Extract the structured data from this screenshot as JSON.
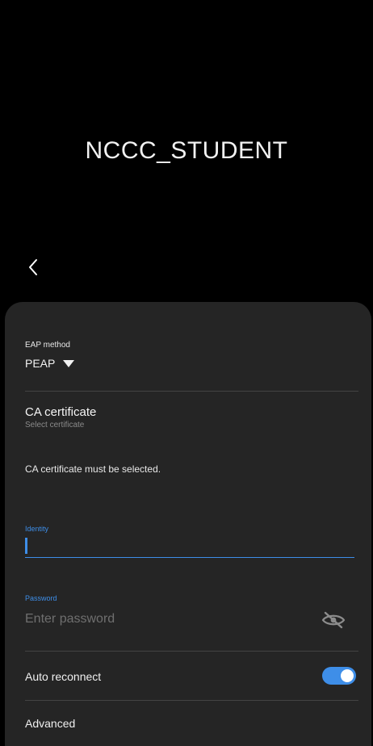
{
  "header": {
    "network_name": "NCCC_STUDENT"
  },
  "form": {
    "eap_method_label": "EAP method",
    "eap_method_value": "PEAP",
    "ca_certificate_title": "CA certificate",
    "ca_certificate_sub": "Select certificate",
    "ca_error": "CA certificate must be selected.",
    "identity_label": "Identity",
    "identity_value": "",
    "password_label": "Password",
    "password_placeholder": "Enter password",
    "auto_reconnect_label": "Auto reconnect",
    "auto_reconnect_on": true,
    "advanced_label": "Advanced"
  },
  "colors": {
    "accent": "#3e8ee8",
    "sheet_bg": "#252525",
    "screen_bg": "#000000"
  },
  "icons": {
    "back": "chevron-left-icon",
    "dropdown": "caret-down-icon",
    "visibility": "eye-off-icon"
  }
}
